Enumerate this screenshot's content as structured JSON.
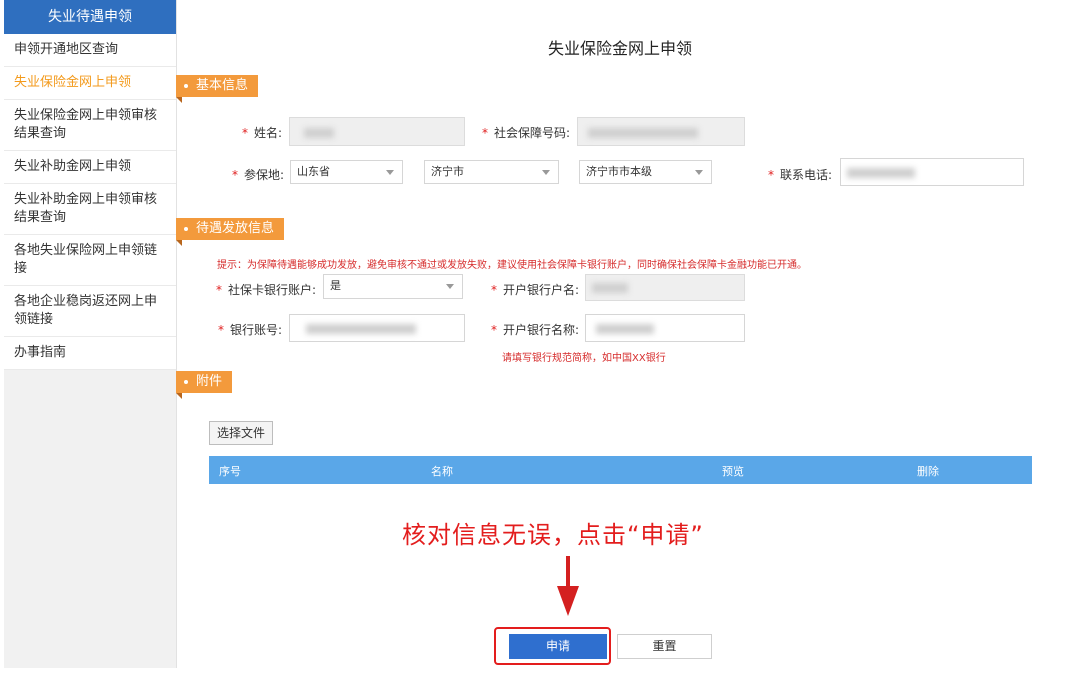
{
  "sidebar": {
    "header": "失业待遇申领",
    "items": [
      {
        "label": "申领开通地区查询"
      },
      {
        "label": "失业保险金网上申领",
        "active": true
      },
      {
        "label": "失业保险金网上申领审核结果查询"
      },
      {
        "label": "失业补助金网上申领"
      },
      {
        "label": "失业补助金网上申领审核结果查询"
      },
      {
        "label": "各地失业保险网上申领链接"
      },
      {
        "label": "各地企业稳岗返还网上申领链接"
      },
      {
        "label": "办事指南"
      }
    ]
  },
  "page": {
    "title": "失业保险金网上申领"
  },
  "sections": {
    "basic": "基本信息",
    "payment": "待遇发放信息",
    "attachment": "附件"
  },
  "basic": {
    "name_label": "姓名:",
    "ssn_label": "社会保障号码:",
    "insured_place_label": "参保地:",
    "province": "山东省",
    "city": "济宁市",
    "district": "济宁市市本级",
    "phone_label": "联系电话:"
  },
  "payment": {
    "tip": "提示：为保障待遇能够成功发放，避免审核不通过或发放失败，建议使用社会保障卡银行账户，同时确保社会保障卡金融功能已开通。",
    "card_account_label": "社保卡银行账户:",
    "card_account_value": "是",
    "account_holder_label": "开户银行户名:",
    "bank_account_label": "银行账号:",
    "bank_name_label": "开户银行名称:",
    "bank_name_hint": "请填写银行规范简称，如中国XX银行"
  },
  "attachment": {
    "choose_file": "选择文件",
    "columns": [
      "序号",
      "名称",
      "预览",
      "删除"
    ]
  },
  "annotation": "核对信息无误，点击“申请”",
  "actions": {
    "apply": "申请",
    "reset": "重置"
  },
  "colors": {
    "accent": "#f39a3c",
    "primary": "#2f6fcf",
    "table_header": "#5aa7e8",
    "annotation": "#e31d1d"
  }
}
